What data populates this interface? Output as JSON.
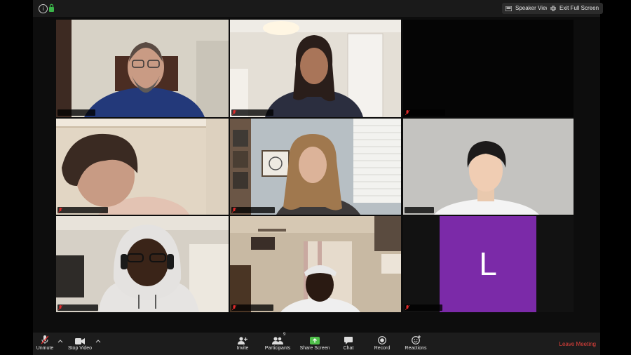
{
  "window": {
    "speaker_view_label": "Speaker View",
    "exit_full_screen_label": "Exit Full Screen"
  },
  "participants": [
    {
      "id": "p1",
      "active_speaker": true,
      "muted": false,
      "video_on": true
    },
    {
      "id": "p2",
      "active_speaker": false,
      "muted": true,
      "video_on": true
    },
    {
      "id": "p3",
      "active_speaker": false,
      "muted": true,
      "video_on": false
    },
    {
      "id": "p4",
      "active_speaker": false,
      "muted": true,
      "video_on": true
    },
    {
      "id": "p5",
      "active_speaker": false,
      "muted": true,
      "video_on": true
    },
    {
      "id": "p6",
      "active_speaker": false,
      "muted": false,
      "video_on": true
    },
    {
      "id": "p7",
      "active_speaker": false,
      "muted": true,
      "video_on": true
    },
    {
      "id": "p8",
      "active_speaker": false,
      "muted": true,
      "video_on": true
    },
    {
      "id": "p9",
      "active_speaker": false,
      "muted": true,
      "video_on": false,
      "avatar_letter": "L",
      "avatar_color": "#7b2aa8"
    }
  ],
  "toolbar": {
    "unmute_label": "Unmute",
    "stop_video_label": "Stop Video",
    "invite_label": "Invite",
    "participants_label": "Participants",
    "participants_count": "9",
    "share_screen_label": "Share Screen",
    "chat_label": "Chat",
    "record_label": "Record",
    "reactions_label": "Reactions",
    "leave_label": "Leave Meeting"
  },
  "colors": {
    "active_speaker_border": "#c5e36b",
    "share_screen_green": "#4fbf4a",
    "leave_red": "#e8423c",
    "muted_red": "#e02b2b"
  }
}
